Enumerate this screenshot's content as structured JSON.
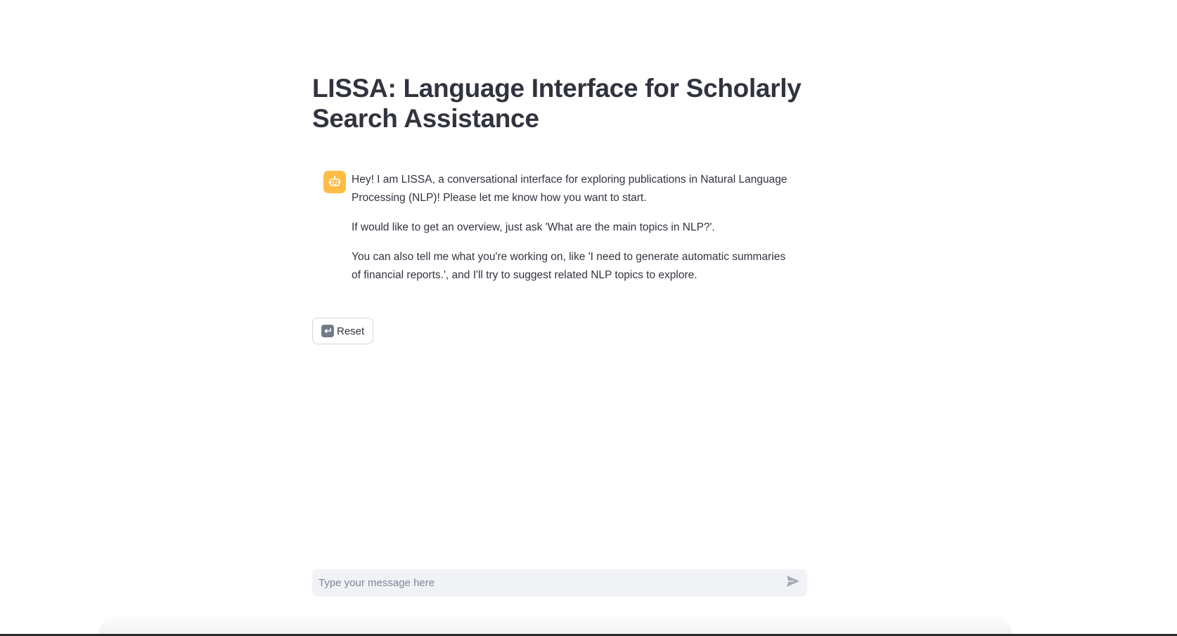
{
  "page": {
    "title": "LISSA: Language Interface for Scholarly Search Assistance"
  },
  "chat": {
    "messages": [
      {
        "role": "assistant",
        "avatar_icon": "robot-face-icon",
        "paragraphs": [
          "Hey! I am LISSA, a conversational interface for exploring publications in Natural Language Processing (NLP)! Please let me know how you want to start.",
          "If would like to get an overview, just ask 'What are the main topics in NLP?'.",
          "You can also tell me what you're working on, like 'I need to generate automatic summaries of financial reports.', and I'll try to suggest related NLP topics to explore."
        ]
      }
    ]
  },
  "actions": {
    "reset_label": "Reset",
    "reset_icon": "return-arrow-icon"
  },
  "input": {
    "placeholder": "Type your message here",
    "value": "",
    "send_icon": "send-arrow-icon"
  },
  "colors": {
    "avatar_bg": "#ffbd45",
    "text": "#31333f",
    "input_bg": "#f0f2f6",
    "placeholder": "#808495"
  }
}
